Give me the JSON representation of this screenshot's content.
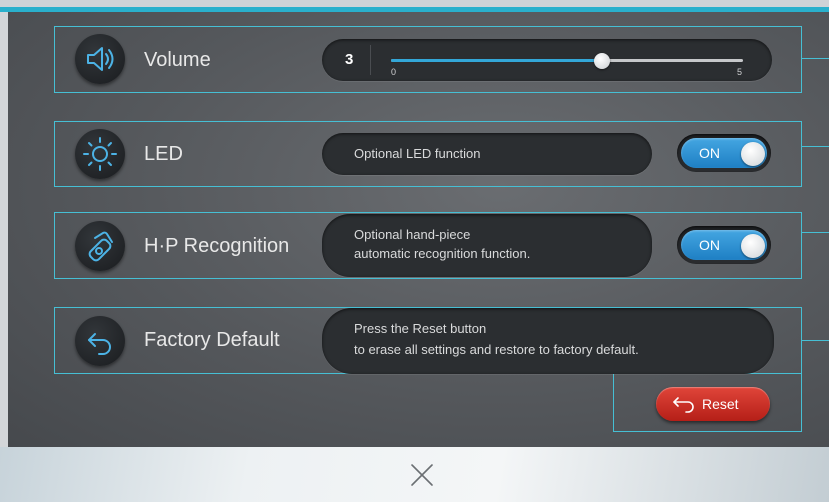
{
  "rows": {
    "volume": {
      "label": "Volume",
      "value_display": "3",
      "slider": {
        "value": 3,
        "min": 0,
        "max": 5,
        "min_label": "0",
        "max_label": "5"
      },
      "icon": "speaker-icon"
    },
    "led": {
      "label": "LED",
      "description": "Optional LED function",
      "toggle_label": "ON",
      "toggle_state": true,
      "icon": "sun-icon"
    },
    "hp_recognition": {
      "label": "H·P Recognition",
      "description_line1": "Optional hand-piece",
      "description_line2": "automatic recognition function.",
      "toggle_label": "ON",
      "toggle_state": true,
      "icon": "handpiece-icon"
    },
    "factory_default": {
      "label": "Factory Default",
      "description_line1": "Press the Reset button",
      "description_line2": "to erase all settings and restore to factory default.",
      "reset_label": "Reset",
      "icon": "return-arrow-icon"
    }
  },
  "footer": {
    "close_icon": "close-icon"
  },
  "colors": {
    "accent": "#2ab0cc",
    "annotation": "#46bfd4",
    "toggle_on": "#2b8fd6",
    "slider_fill": "#33a7d8",
    "reset": "#cc2f25"
  }
}
